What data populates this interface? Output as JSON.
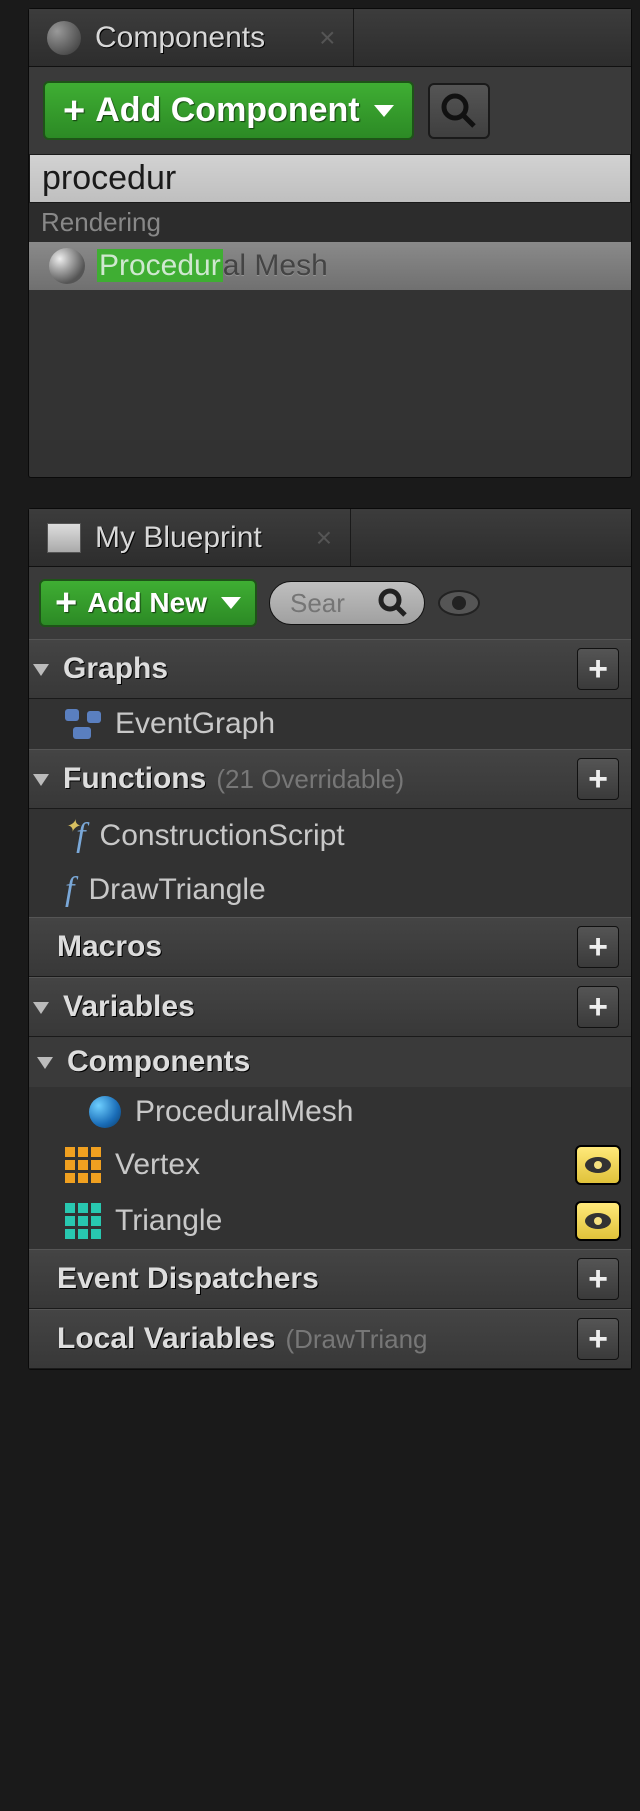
{
  "components_panel": {
    "title": "Components",
    "add_button": "Add Component",
    "search_value": "procedur",
    "category": "Rendering",
    "result_highlight": "Procedur",
    "result_rest": "al Mesh"
  },
  "blueprint_panel": {
    "title": "My Blueprint",
    "add_button": "Add New",
    "search_placeholder": "Sear",
    "sections": {
      "graphs": {
        "title": "Graphs",
        "items": [
          "EventGraph"
        ]
      },
      "functions": {
        "title": "Functions",
        "subtitle": "(21 Overridable)",
        "items": [
          "ConstructionScript",
          "DrawTriangle"
        ]
      },
      "macros": {
        "title": "Macros"
      },
      "variables": {
        "title": "Variables"
      },
      "components": {
        "title": "Components",
        "items": [
          "ProceduralMesh",
          "Vertex",
          "Triangle"
        ]
      },
      "event_dispatchers": {
        "title": "Event Dispatchers"
      },
      "local_variables": {
        "title": "Local Variables",
        "subtitle": "(DrawTriang"
      }
    }
  }
}
